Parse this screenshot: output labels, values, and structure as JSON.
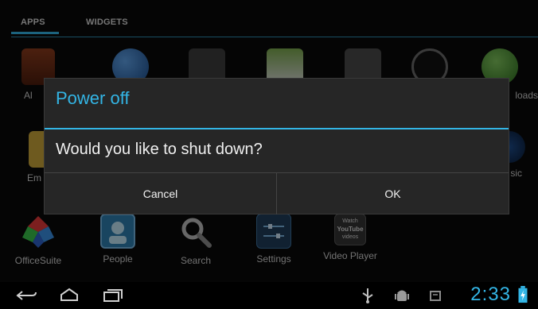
{
  "tabs": {
    "apps": "APPS",
    "widgets": "WIDGETS"
  },
  "apps_top_partial": [
    {
      "name": "alarm-clock-app",
      "label": "Al"
    },
    {
      "name": "browser-app",
      "label": ""
    },
    {
      "name": "calculator-app",
      "label": ""
    },
    {
      "name": "calendar-app",
      "label": ""
    },
    {
      "name": "camera-app",
      "label": ""
    },
    {
      "name": "clock-app",
      "label": ""
    },
    {
      "name": "downloads-app",
      "label": "loads"
    }
  ],
  "apps_mid_partial": [
    {
      "name": "email-app",
      "label": "Em"
    },
    {
      "name": "music-app",
      "label": "sic"
    }
  ],
  "apps_bottom": [
    {
      "name": "officesuite-app",
      "label": "OfficeSuite"
    },
    {
      "name": "people-app",
      "label": "People"
    },
    {
      "name": "search-app",
      "label": "Search"
    },
    {
      "name": "settings-app",
      "label": "Settings"
    },
    {
      "name": "video-player-app",
      "label": "Video Player"
    }
  ],
  "video_player_icon_text": [
    "Watch",
    "YouTube",
    "videos"
  ],
  "dialog": {
    "title": "Power off",
    "message": "Would you like to shut down?",
    "cancel": "Cancel",
    "ok": "OK"
  },
  "status": {
    "time": "2:33"
  },
  "colors": {
    "accent": "#33b5e5",
    "dialog_bg": "#262626",
    "background": "#0a0a0a"
  }
}
